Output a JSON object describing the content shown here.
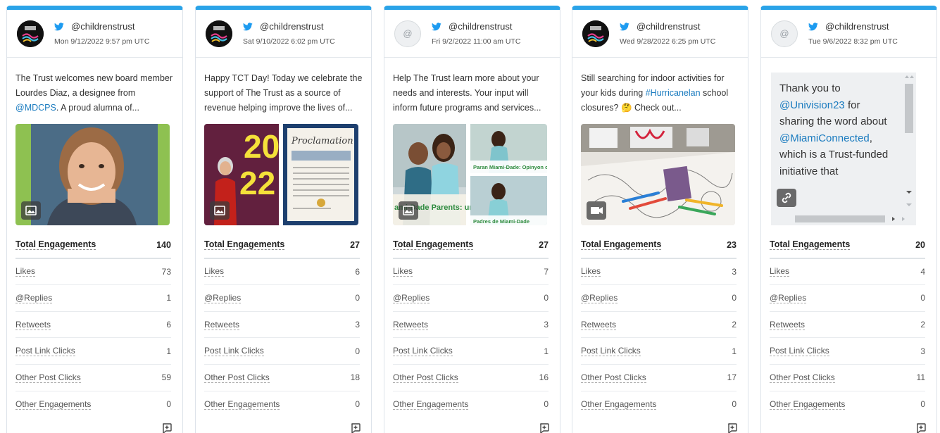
{
  "cards": [
    {
      "handle": "@childrenstrust",
      "timestamp": "Mon 9/12/2022 9:57 pm UTC",
      "text_pre": "The Trust welcomes new board member Lourdes Diaz, a designee from ",
      "text_link": "@MDCPS",
      "text_post": ". A proud alumna of...",
      "media_type": "image",
      "avatar": "logo",
      "stats": {
        "total_label": "Total Engagements",
        "total": "140",
        "likes_label": "Likes",
        "likes": "73",
        "replies_label": "@Replies",
        "replies": "1",
        "retweets_label": "Retweets",
        "retweets": "6",
        "link_clicks_label": "Post Link Clicks",
        "link_clicks": "1",
        "other_clicks_label": "Other Post Clicks",
        "other_clicks": "59",
        "other_eng_label": "Other Engagements",
        "other_eng": "0"
      }
    },
    {
      "handle": "@childrenstrust",
      "timestamp": "Sat 9/10/2022 6:02 pm UTC",
      "text_pre": "Happy TCT Day! Today we celebrate the support of The Trust as a source of revenue helping improve the lives of...",
      "text_link": "",
      "text_post": "",
      "media_type": "image",
      "avatar": "logo",
      "media_text": {
        "year_a": "20",
        "year_b": "22",
        "proclamation": "Proclamation"
      },
      "stats": {
        "total_label": "Total Engagements",
        "total": "27",
        "likes_label": "Likes",
        "likes": "6",
        "replies_label": "@Replies",
        "replies": "0",
        "retweets_label": "Retweets",
        "retweets": "3",
        "link_clicks_label": "Post Link Clicks",
        "link_clicks": "0",
        "other_clicks_label": "Other Post Clicks",
        "other_clicks": "18",
        "other_eng_label": "Other Engagements",
        "other_eng": "0"
      }
    },
    {
      "handle": "@childrenstrust",
      "timestamp": "Fri 9/2/2022 11:00 am UTC",
      "text_pre": "Help The Trust learn more about your needs and interests. Your input will inform future programs and services...",
      "text_link": "",
      "text_post": "",
      "media_type": "image",
      "avatar": "placeholder",
      "media_text": {
        "banner_a": "Paran Miami-Dade: Opinyon ou enpòtan!",
        "banner_b": "ami-Dade Parents: ur Opinion Matters",
        "banner_c": "Padres de Miami-Dade"
      },
      "stats": {
        "total_label": "Total Engagements",
        "total": "27",
        "likes_label": "Likes",
        "likes": "7",
        "replies_label": "@Replies",
        "replies": "0",
        "retweets_label": "Retweets",
        "retweets": "3",
        "link_clicks_label": "Post Link Clicks",
        "link_clicks": "1",
        "other_clicks_label": "Other Post Clicks",
        "other_clicks": "16",
        "other_eng_label": "Other Engagements",
        "other_eng": "0"
      }
    },
    {
      "handle": "@childrenstrust",
      "timestamp": "Wed 9/28/2022 6:25 pm UTC",
      "text_pre": "Still searching for indoor activities for your kids during ",
      "text_link": "#Hurricanelan",
      "text_post": " school closures? 🤔 Check out...",
      "media_type": "video",
      "avatar": "logo",
      "stats": {
        "total_label": "Total Engagements",
        "total": "23",
        "likes_label": "Likes",
        "likes": "3",
        "replies_label": "@Replies",
        "replies": "0",
        "retweets_label": "Retweets",
        "retweets": "2",
        "link_clicks_label": "Post Link Clicks",
        "link_clicks": "1",
        "other_clicks_label": "Other Post Clicks",
        "other_clicks": "17",
        "other_eng_label": "Other Engagements",
        "other_eng": "0"
      }
    },
    {
      "handle": "@childrenstrust",
      "timestamp": "Tue 9/6/2022 8:32 pm UTC",
      "text_a": "Thank you to ",
      "link_a": "@Univision23",
      "text_b": " for sharing the word about ",
      "link_b": "@MiamiConnected",
      "text_c": ", which is a Trust-funded initiative that",
      "media_type": "link",
      "avatar": "placeholder",
      "stats": {
        "total_label": "Total Engagements",
        "total": "20",
        "likes_label": "Likes",
        "likes": "4",
        "replies_label": "@Replies",
        "replies": "0",
        "retweets_label": "Retweets",
        "retweets": "2",
        "link_clicks_label": "Post Link Clicks",
        "link_clicks": "3",
        "other_clicks_label": "Other Post Clicks",
        "other_clicks": "11",
        "other_eng_label": "Other Engagements",
        "other_eng": "0"
      }
    }
  ],
  "colors": {
    "accent": "#2aa3e8",
    "link": "#1a7bbf",
    "twitter": "#1d9bf0"
  },
  "avatar_placeholder_symbol": "@"
}
